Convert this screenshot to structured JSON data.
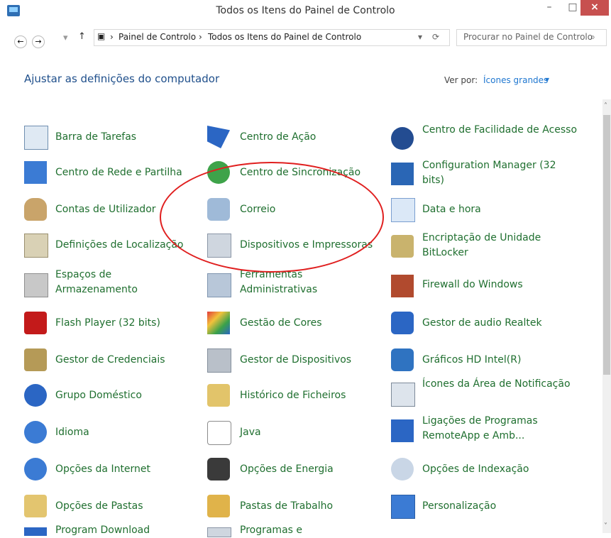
{
  "window": {
    "title": "Todos os Itens do Painel de Controlo",
    "controls": {
      "minimize": "–",
      "maximize": "□",
      "close": "×"
    }
  },
  "address": {
    "crumb1": "Painel de Controlo",
    "crumb2": "Todos os Itens do Painel de Controlo",
    "search_placeholder": "Procurar no Painel de Controlo"
  },
  "header": {
    "title": "Ajustar as definições do computador",
    "view_by_label": "Ver por:",
    "view_by_value": "Ícones grandes"
  },
  "items": [
    {
      "id": "barra-tarefas",
      "label": "Barra de Tarefas",
      "icon": "taskbar-icon"
    },
    {
      "id": "centro-acao",
      "label": "Centro de Ação",
      "icon": "flag-icon"
    },
    {
      "id": "centro-facilidade",
      "label": "Centro de Facilidade de Acesso",
      "icon": "accessibility-icon"
    },
    {
      "id": "centro-rede",
      "label": "Centro de Rede e Partilha",
      "icon": "network-icon"
    },
    {
      "id": "centro-sync",
      "label": "Centro de Sincronização",
      "icon": "sync-icon"
    },
    {
      "id": "config-manager",
      "label": "Configuration Manager (32 bits)",
      "icon": "config-manager-icon"
    },
    {
      "id": "contas",
      "label": "Contas de Utilizador",
      "icon": "users-icon"
    },
    {
      "id": "correio",
      "label": "Correio",
      "icon": "mail-icon"
    },
    {
      "id": "data-hora",
      "label": "Data e hora",
      "icon": "clock-calendar-icon"
    },
    {
      "id": "def-localizacao",
      "label": "Definições de Localização",
      "icon": "location-icon"
    },
    {
      "id": "dispositivos",
      "label": "Dispositivos e Impressoras",
      "icon": "printer-icon"
    },
    {
      "id": "encriptacao",
      "label": "Encriptação de Unidade BitLocker",
      "icon": "bitlocker-icon"
    },
    {
      "id": "espacos",
      "label": "Espaços de Armazenamento",
      "icon": "storage-icon"
    },
    {
      "id": "ferramentas",
      "label": "Ferramentas Administrativas",
      "icon": "admin-tools-icon"
    },
    {
      "id": "firewall",
      "label": "Firewall do Windows",
      "icon": "firewall-icon"
    },
    {
      "id": "flash",
      "label": "Flash Player (32 bits)",
      "icon": "flash-icon"
    },
    {
      "id": "gestao-cores",
      "label": "Gestão de Cores",
      "icon": "color-management-icon"
    },
    {
      "id": "gestor-audio",
      "label": "Gestor de audio Realtek",
      "icon": "audio-icon"
    },
    {
      "id": "gestor-credenciais",
      "label": "Gestor de Credenciais",
      "icon": "credentials-icon"
    },
    {
      "id": "gestor-dispositivos",
      "label": "Gestor de Dispositivos",
      "icon": "device-manager-icon"
    },
    {
      "id": "graficos",
      "label": "Gráficos HD Intel(R)",
      "icon": "graphics-icon"
    },
    {
      "id": "grupo-domestico",
      "label": "Grupo Doméstico",
      "icon": "homegroup-icon"
    },
    {
      "id": "historico",
      "label": "Histórico de Ficheiros",
      "icon": "file-history-icon"
    },
    {
      "id": "icones-area",
      "label": "Ícones da Área de Notificação",
      "icon": "tray-icons-icon"
    },
    {
      "id": "idioma",
      "label": "Idioma",
      "icon": "language-icon"
    },
    {
      "id": "java",
      "label": "Java",
      "icon": "java-icon"
    },
    {
      "id": "remoteapp",
      "label": "Ligações de Programas RemoteApp e Amb...",
      "icon": "remoteapp-icon"
    },
    {
      "id": "opcoes-internet",
      "label": "Opções da Internet",
      "icon": "internet-icon"
    },
    {
      "id": "opcoes-energia",
      "label": "Opções de Energia",
      "icon": "power-icon"
    },
    {
      "id": "opcoes-indexacao",
      "label": "Opções de Indexação",
      "icon": "indexing-icon"
    },
    {
      "id": "opcoes-pastas",
      "label": "Opções de Pastas",
      "icon": "folder-options-icon"
    },
    {
      "id": "pastas-trabalho",
      "label": "Pastas de Trabalho",
      "icon": "work-folders-icon"
    },
    {
      "id": "personalizacao",
      "label": "Personalização",
      "icon": "personalization-icon"
    },
    {
      "id": "program-download",
      "label": "Program Download",
      "icon": "download-icon"
    },
    {
      "id": "programas",
      "label": "Programas e",
      "icon": "programs-icon"
    }
  ]
}
